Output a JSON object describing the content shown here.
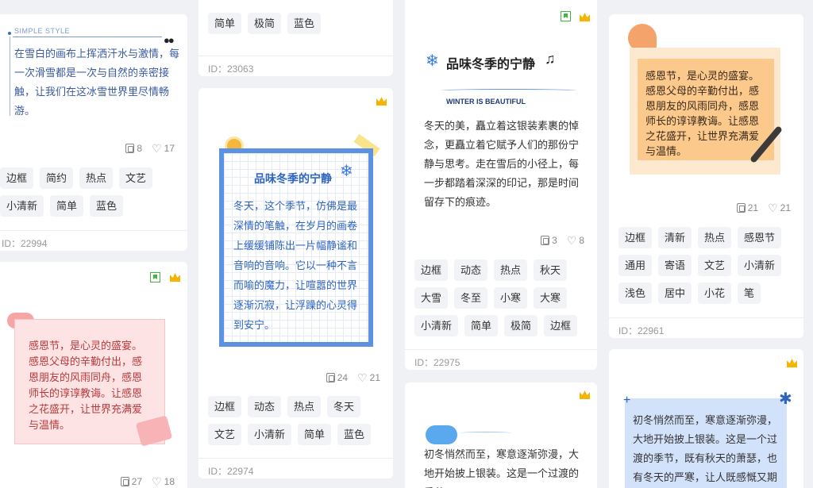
{
  "colors": {
    "crown": "#f5b400",
    "bookmark": "#41b441",
    "tagbg": "#f2f3f6"
  },
  "cards": {
    "c1": {
      "deco_label": "SIMPLE STYLE",
      "text": "在雪白的画布上挥洒汗水与激情，每一次滑雪都是一次与自然的亲密接触，让我们在这冰雪世界里尽情畅游。",
      "copies": "8",
      "likes": "17",
      "tags": [
        "边框",
        "简约",
        "热点",
        "文艺",
        "小清新",
        "简单",
        "蓝色"
      ],
      "id": "ID：22994"
    },
    "c2": {
      "text": "感恩节，是心灵的盛宴。感恩父母的辛勤付出，感恩朋友的风雨同舟，感恩师长的谆谆教诲。让感恩之花盛开，让世界充满爱与温情。",
      "copies": "27",
      "likes": "18"
    },
    "c3": {
      "tags": [
        "简单",
        "极简",
        "蓝色"
      ],
      "id": "ID：23063"
    },
    "c4": {
      "title": "品味冬季的宁静",
      "text": "冬天，这个季节，仿佛是最深情的笔触，在岁月的画卷上缓缓铺陈出一片幅静谧和音响的音响。它以一种不言而喻的魔力，让喧嚣的世界逐渐沉寂，让浮躁的心灵得到安宁。",
      "copies": "24",
      "likes": "21",
      "tags": [
        "边框",
        "动态",
        "热点",
        "冬天",
        "文艺",
        "小清新",
        "简单",
        "蓝色"
      ],
      "id": "ID：22974"
    },
    "c5": {
      "title": "品味冬季的宁静",
      "subtitle": "WINTER IS BEAUTIFUL",
      "text": "冬天的美，矗立着这银装素裹的悼念，更矗立着它赋予人们的那份宁静与思考。走在雪后的小径上，每一步都踏着深深的印记，那是时间留存下的痕迹。",
      "copies": "3",
      "likes": "8",
      "tags": [
        "边框",
        "动态",
        "热点",
        "秋天",
        "大雪",
        "冬至",
        "小寒",
        "大寒",
        "小清新",
        "简单",
        "极简",
        "边框"
      ],
      "id": "ID：22975"
    },
    "c6": {
      "text": "初冬悄然而至，寒意逐渐弥漫，大地开始披上银装。这是一个过渡的季节，"
    },
    "c7": {
      "text": "感恩节，是心灵的盛宴。感恩父母的辛勤付出，感恩朋友的风雨同舟，感恩师长的谆谆教诲。让感恩之花盛开，让世界充满爱与温情。",
      "copies": "21",
      "likes": "21",
      "tags": [
        "边框",
        "清新",
        "热点",
        "感恩节",
        "通用",
        "寄语",
        "文艺",
        "小清新",
        "浅色",
        "居中",
        "小花",
        "笔"
      ],
      "id": "ID：22961"
    },
    "c8": {
      "text": "初冬悄然而至，寒意逐渐弥漫，大地开始披上银装。这是一个过渡的季节，既有秋天的萧瑟，也有冬天的严寒，让人既感慨又期"
    }
  }
}
